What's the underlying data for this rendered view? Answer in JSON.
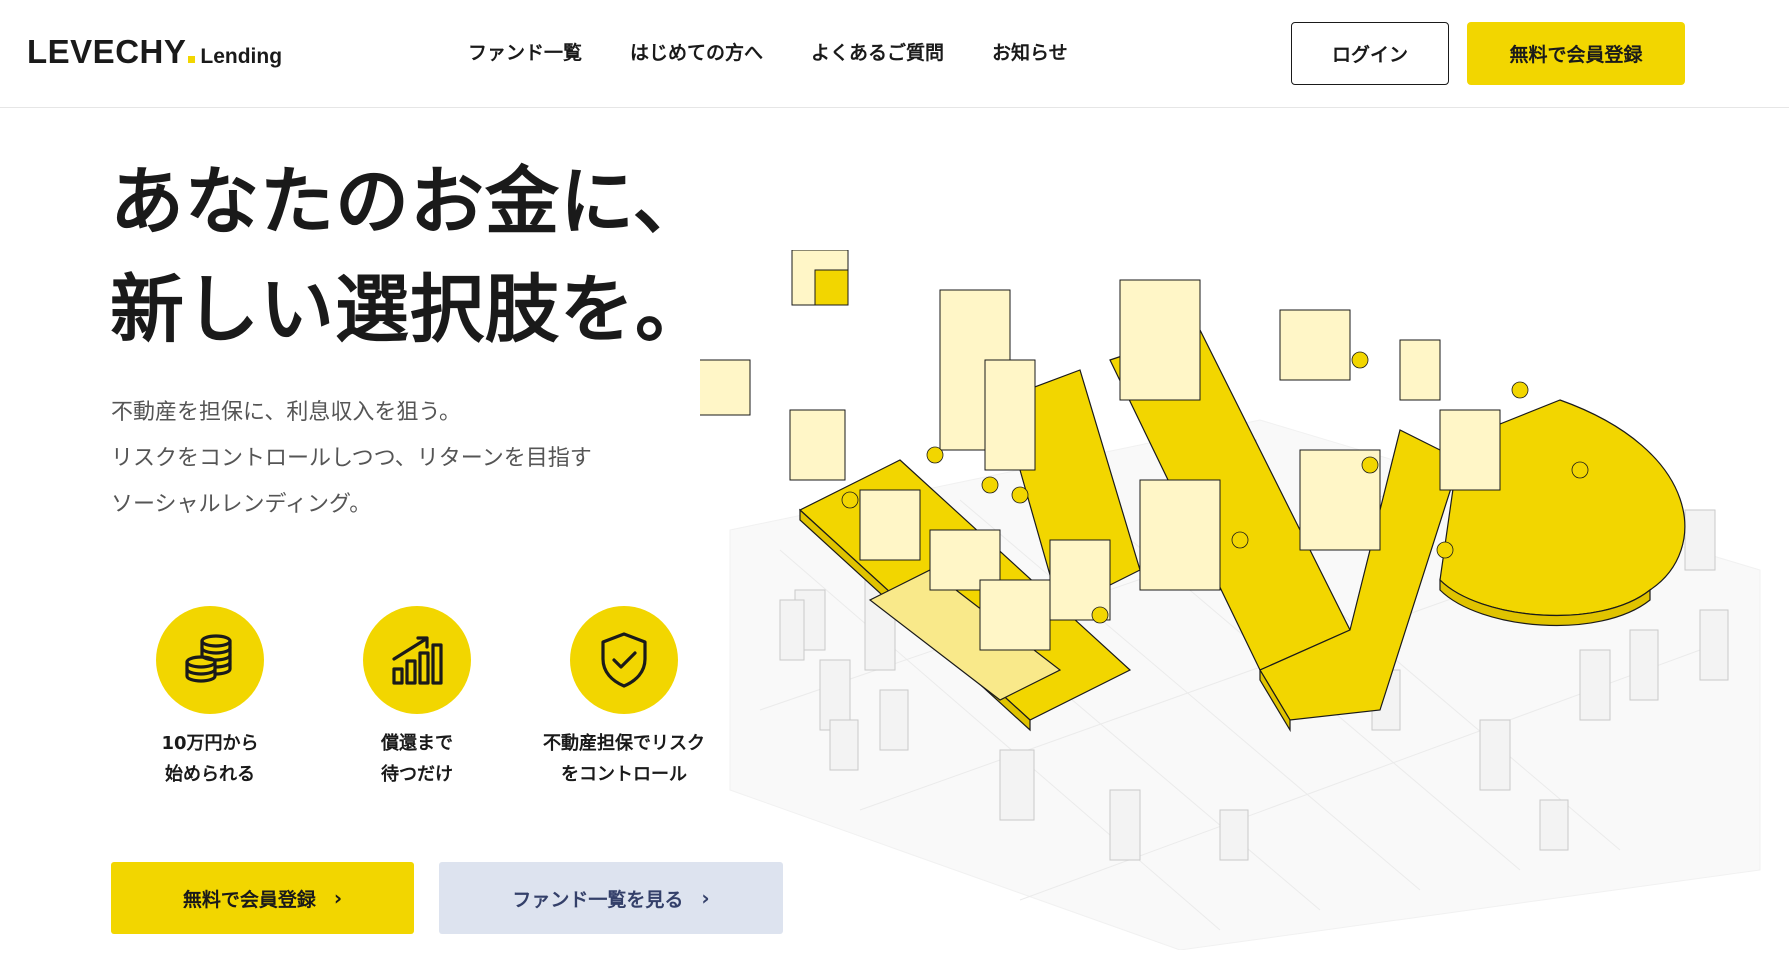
{
  "header": {
    "logo_main": "LEVECHY",
    "logo_sub": "Lending",
    "nav": [
      "ファンド一覧",
      "はじめての方へ",
      "よくあるご質問",
      "お知らせ"
    ],
    "login_label": "ログイン",
    "register_label": "無料で会員登録"
  },
  "hero": {
    "title_lines": [
      "あなたのお金に、",
      "新しい選択肢を。"
    ],
    "description_lines": [
      "不動産を担保に、利息収入を狙う。",
      "リスクをコントロールしつつ、リターンを目指す",
      "ソーシャルレンディング。"
    ]
  },
  "features": [
    {
      "icon": "coins-icon",
      "lines": [
        "10万円から",
        "始められる"
      ]
    },
    {
      "icon": "growth-chart-icon",
      "lines": [
        "償還まで",
        "待つだけ"
      ]
    },
    {
      "icon": "shield-check-icon",
      "lines": [
        "不動産担保でリスク",
        "をコントロール"
      ]
    }
  ],
  "cta": {
    "register_label": "無料で会員登録",
    "funds_label": "ファンド一覧を見る",
    "chevron": "›"
  },
  "colors": {
    "accent": "#f2d600",
    "secondary_button": "#dde3ef",
    "secondary_text": "#34406a",
    "text": "#1a1a1a"
  }
}
